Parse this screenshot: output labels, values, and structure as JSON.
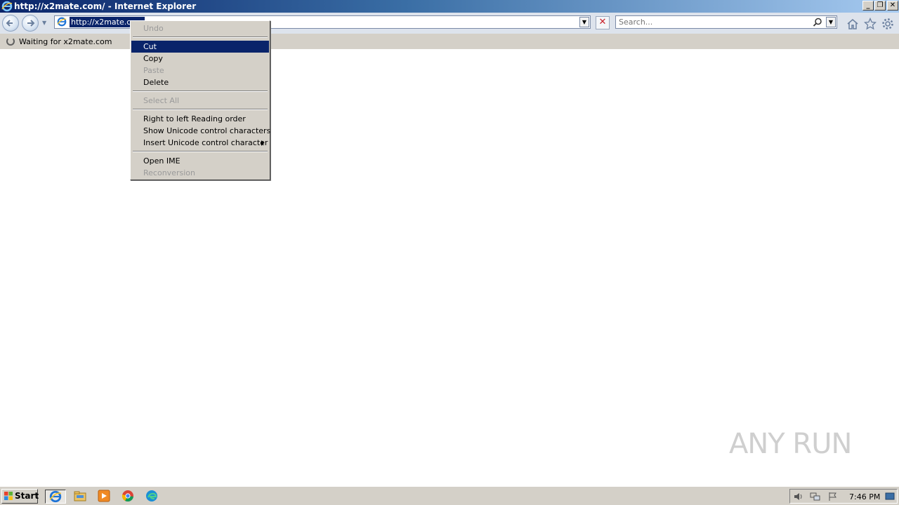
{
  "window": {
    "title": "http://x2mate.com/ - Internet Explorer"
  },
  "navbar": {
    "address_value": "http://x2mate.com/",
    "address_selected_text": "http://x2mate.com",
    "search_placeholder": "Search..."
  },
  "status": {
    "text": "Waiting for x2mate.com"
  },
  "context_menu": {
    "items": [
      {
        "label": "Undo",
        "enabled": false
      },
      {
        "label": "Cut",
        "enabled": true,
        "highlighted": true
      },
      {
        "label": "Copy",
        "enabled": true
      },
      {
        "label": "Paste",
        "enabled": false
      },
      {
        "label": "Delete",
        "enabled": true
      },
      {
        "label": "Select All",
        "enabled": false
      },
      {
        "label": "Right to left Reading order",
        "enabled": true
      },
      {
        "label": "Show Unicode control characters",
        "enabled": true
      },
      {
        "label": "Insert Unicode control character",
        "enabled": true,
        "submenu": true
      },
      {
        "label": "Open IME",
        "enabled": true
      },
      {
        "label": "Reconversion",
        "enabled": false
      }
    ]
  },
  "watermark": {
    "text": "ANY RUN"
  },
  "taskbar": {
    "start_label": "Start",
    "clock": "7:46 PM",
    "pinned": [
      "internet-explorer-icon",
      "file-explorer-icon",
      "media-player-icon",
      "chrome-icon",
      "edge-icon"
    ]
  },
  "colors": {
    "title_gradient_start": "#0a246a",
    "selection": "#0a246a",
    "menu_bg": "#d4d0c8",
    "stop_red": "#c8202a"
  }
}
